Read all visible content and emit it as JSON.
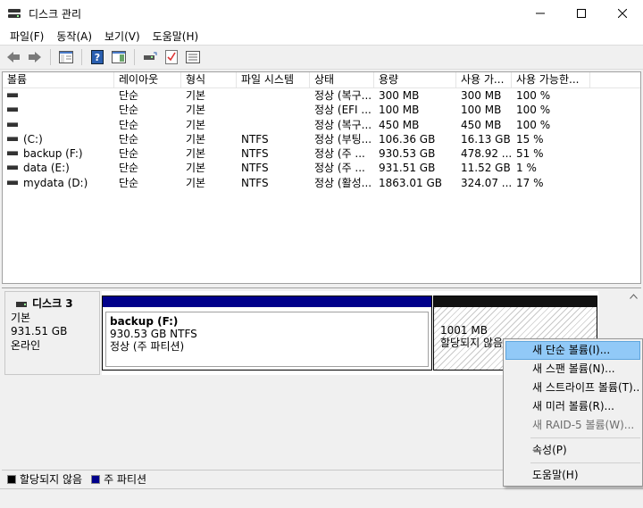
{
  "window": {
    "title": "디스크 관리",
    "icon": "disk-management-icon",
    "minimize_icon": "minimize-icon",
    "maximize_icon": "maximize-icon",
    "close_icon": "close-icon"
  },
  "menu": {
    "file": "파일(F)",
    "action": "동작(A)",
    "view": "보기(V)",
    "help": "도움말(H)"
  },
  "toolbar": {
    "icons": [
      "back-arrow-icon",
      "forward-arrow-icon",
      "console-tree-icon",
      "help-icon",
      "detail-pane-icon",
      "connect-drive-icon",
      "check-icon",
      "properties-icon"
    ]
  },
  "volumes": {
    "columns": [
      "볼륨",
      "레이아웃",
      "형식",
      "파일 시스템",
      "상태",
      "용량",
      "사용 가...",
      "사용 가능한..."
    ],
    "rows": [
      {
        "name": "",
        "layout": "단순",
        "type": "기본",
        "fs": "",
        "status": "정상 (복구...",
        "capacity": "300 MB",
        "free": "300 MB",
        "pct": "100 %"
      },
      {
        "name": "",
        "layout": "단순",
        "type": "기본",
        "fs": "",
        "status": "정상 (EFI ...",
        "capacity": "100 MB",
        "free": "100 MB",
        "pct": "100 %"
      },
      {
        "name": "",
        "layout": "단순",
        "type": "기본",
        "fs": "",
        "status": "정상 (복구...",
        "capacity": "450 MB",
        "free": "450 MB",
        "pct": "100 %"
      },
      {
        "name": "(C:)",
        "layout": "단순",
        "type": "기본",
        "fs": "NTFS",
        "status": "정상 (부팅...",
        "capacity": "106.36 GB",
        "free": "16.13 GB",
        "pct": "15 %"
      },
      {
        "name": "backup (F:)",
        "layout": "단순",
        "type": "기본",
        "fs": "NTFS",
        "status": "정상 (주 ...",
        "capacity": "930.53 GB",
        "free": "478.92 ...",
        "pct": "51 %"
      },
      {
        "name": "data (E:)",
        "layout": "단순",
        "type": "기본",
        "fs": "NTFS",
        "status": "정상 (주 ...",
        "capacity": "931.51 GB",
        "free": "11.52 GB",
        "pct": "1 %"
      },
      {
        "name": "mydata (D:)",
        "layout": "단순",
        "type": "기본",
        "fs": "NTFS",
        "status": "정상 (활성...",
        "capacity": "1863.01 GB",
        "free": "324.07 ...",
        "pct": "17 %"
      }
    ]
  },
  "disk": {
    "name": "디스크 3",
    "type": "기본",
    "size": "931.51 GB",
    "state": "온라인",
    "primary": {
      "name": "backup  (F:)",
      "size_fs": "930.53 GB NTFS",
      "status": "정상 (주 파티션)"
    },
    "unallocated": {
      "size": "1001 MB",
      "status": "할당되지 않음"
    }
  },
  "legend": {
    "unallocated": "할당되지 않음",
    "primary": "주 파티션",
    "unallocated_color": "#000000",
    "primary_color": "#00008b"
  },
  "context_menu": {
    "items": [
      {
        "label": "새 단순 볼륨(I)...",
        "state": "hover"
      },
      {
        "label": "새 스팬 볼륨(N)...",
        "state": "enabled"
      },
      {
        "label": "새 스트라이프 볼륨(T)...",
        "state": "enabled"
      },
      {
        "label": "새 미러 볼륨(R)...",
        "state": "enabled"
      },
      {
        "label": "새 RAID-5 볼륨(W)...",
        "state": "disabled"
      },
      {
        "label": "속성(P)",
        "state": "enabled"
      },
      {
        "label": "도움말(H)",
        "state": "enabled"
      }
    ]
  }
}
